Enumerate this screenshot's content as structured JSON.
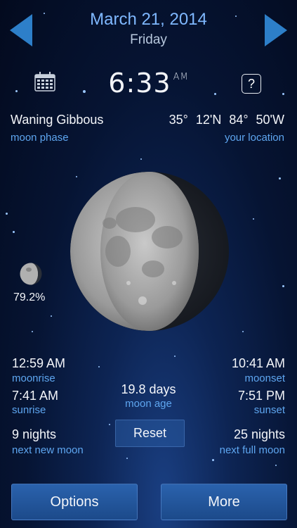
{
  "header": {
    "date": "March 21, 2014",
    "weekday": "Friday",
    "prev_icon": "left-arrow-icon",
    "next_icon": "right-arrow-icon"
  },
  "time": {
    "value": "6:33",
    "ampm": "AM",
    "calendar_icon": "calendar-icon",
    "help_label": "?"
  },
  "phase": {
    "name": "Waning Gibbous",
    "label": "moon phase",
    "illumination": "79.2%"
  },
  "location": {
    "coords": "35° 12'N  84° 50'W",
    "label": "your location"
  },
  "stats": {
    "moonrise": {
      "value": "12:59 AM",
      "label": "moonrise"
    },
    "moonset": {
      "value": "10:41 AM",
      "label": "moonset"
    },
    "sunrise": {
      "value": "7:41 AM",
      "label": "sunrise"
    },
    "sunset": {
      "value": "7:51 PM",
      "label": "sunset"
    },
    "moon_age": {
      "value": "19.8 days",
      "label": "moon age"
    },
    "next_new_moon": {
      "value": "9 nights",
      "label": "next new moon"
    },
    "next_full_moon": {
      "value": "25 nights",
      "label": "next full moon"
    }
  },
  "buttons": {
    "reset": "Reset",
    "options": "Options",
    "more": "More"
  },
  "colors": {
    "accent": "#5ea6f0",
    "date": "#7fb8ff",
    "button": "#2a62ad",
    "background": "#061433"
  }
}
